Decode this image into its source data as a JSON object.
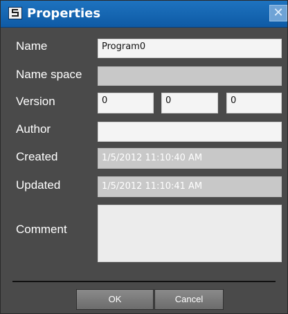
{
  "window": {
    "title": "Properties",
    "close_glyph": "✕",
    "icon": "app-icon"
  },
  "form": {
    "name": {
      "label": "Name",
      "value": "Program0"
    },
    "namespace": {
      "label": "Name space",
      "value": ""
    },
    "version": {
      "label": "Version",
      "major": "0",
      "minor": "0",
      "build": "0"
    },
    "author": {
      "label": "Author",
      "value": ""
    },
    "created": {
      "label": "Created",
      "value": "1/5/2012 11:10:40 AM"
    },
    "updated": {
      "label": "Updated",
      "value": "1/5/2012 11:10:41 AM"
    },
    "comment": {
      "label": "Comment",
      "value": ""
    }
  },
  "buttons": {
    "ok": "OK",
    "cancel": "Cancel"
  }
}
